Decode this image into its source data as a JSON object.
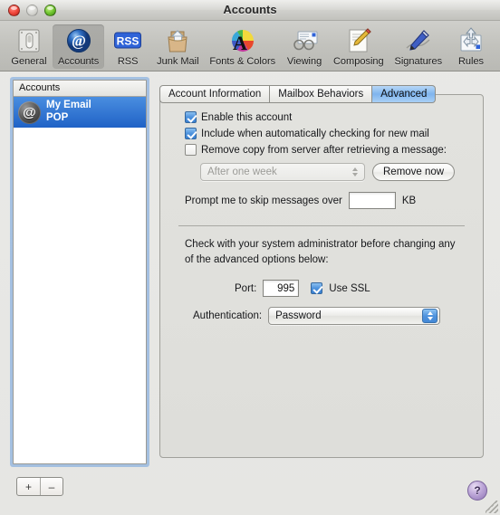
{
  "window": {
    "title": "Accounts",
    "traffic": {
      "close": "close",
      "minimize": "minimize",
      "zoom": "zoom"
    }
  },
  "toolbar": {
    "items": [
      {
        "label": "General",
        "icon": "general-icon"
      },
      {
        "label": "Accounts",
        "icon": "accounts-at-icon"
      },
      {
        "label": "RSS",
        "icon": "rss-icon"
      },
      {
        "label": "Junk Mail",
        "icon": "junk-mail-icon"
      },
      {
        "label": "Fonts & Colors",
        "icon": "fonts-colors-icon"
      },
      {
        "label": "Viewing",
        "icon": "viewing-icon"
      },
      {
        "label": "Composing",
        "icon": "composing-icon"
      },
      {
        "label": "Signatures",
        "icon": "signatures-icon"
      },
      {
        "label": "Rules",
        "icon": "rules-icon"
      }
    ],
    "selected": "Accounts"
  },
  "accounts_list": {
    "header": "Accounts",
    "items": [
      {
        "name": "My Email",
        "type": "POP",
        "avatar_glyph": "@",
        "selected": true
      }
    ],
    "add_label": "+",
    "remove_label": "–"
  },
  "tabs": [
    {
      "label": "Account Information",
      "active": false
    },
    {
      "label": "Mailbox Behaviors",
      "active": false
    },
    {
      "label": "Advanced",
      "active": true
    }
  ],
  "advanced": {
    "checkboxes": [
      {
        "label": "Enable this account",
        "checked": true
      },
      {
        "label": "Include when automatically checking for new mail",
        "checked": true
      },
      {
        "label": "Remove copy from server after retrieving a message:",
        "checked": false
      }
    ],
    "remove_interval": {
      "value": "After one week",
      "enabled": false
    },
    "remove_now_label": "Remove now",
    "skip_label": "Prompt me to skip messages over",
    "skip_value": "",
    "skip_unit": "KB",
    "note": "Check with your system administrator before changing any of the advanced options below:",
    "port_label": "Port:",
    "port_value": "995",
    "use_ssl_label": "Use SSL",
    "use_ssl_checked": true,
    "auth_label": "Authentication:",
    "auth_value": "Password"
  },
  "help": {
    "glyph": "?"
  },
  "colors": {
    "selection_blue": "#1f62c6",
    "tab_active": "#7fb4ee",
    "window_bg": "#e2e2de",
    "help_purple": "#8f75b5"
  }
}
